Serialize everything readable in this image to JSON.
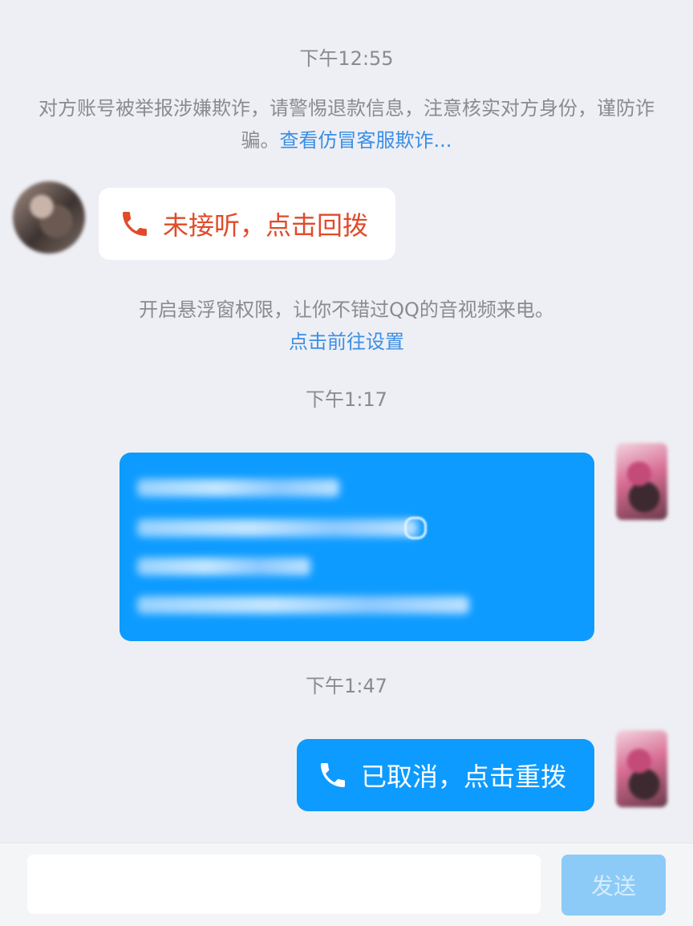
{
  "colors": {
    "background": "#eeeff4",
    "link": "#3a8ee6",
    "missed_call": "#e04b2a",
    "outgoing_bubble": "#0d9bff",
    "send_button_disabled": "#8ccbf8"
  },
  "messages": {
    "timestamp_1": "下午12:55",
    "fraud_notice_text": "对方账号被举报涉嫌欺诈，请警惕退款信息，注意核实对方身份，谨防诈骗。",
    "fraud_notice_link": "查看仿冒客服欺诈...",
    "missed_call": {
      "icon": "phone-icon",
      "label": "未接听，点击回拨"
    },
    "float_window_notice": "开启悬浮窗权限，让你不错过QQ的音视频来电。",
    "float_window_link": "点击前往设置",
    "timestamp_2": "下午1:17",
    "timestamp_3": "下午1:47",
    "cancelled_call": {
      "icon": "phone-icon",
      "label": "已取消，点击重拨"
    }
  },
  "input_bar": {
    "input_value": "",
    "send_label": "发送"
  }
}
